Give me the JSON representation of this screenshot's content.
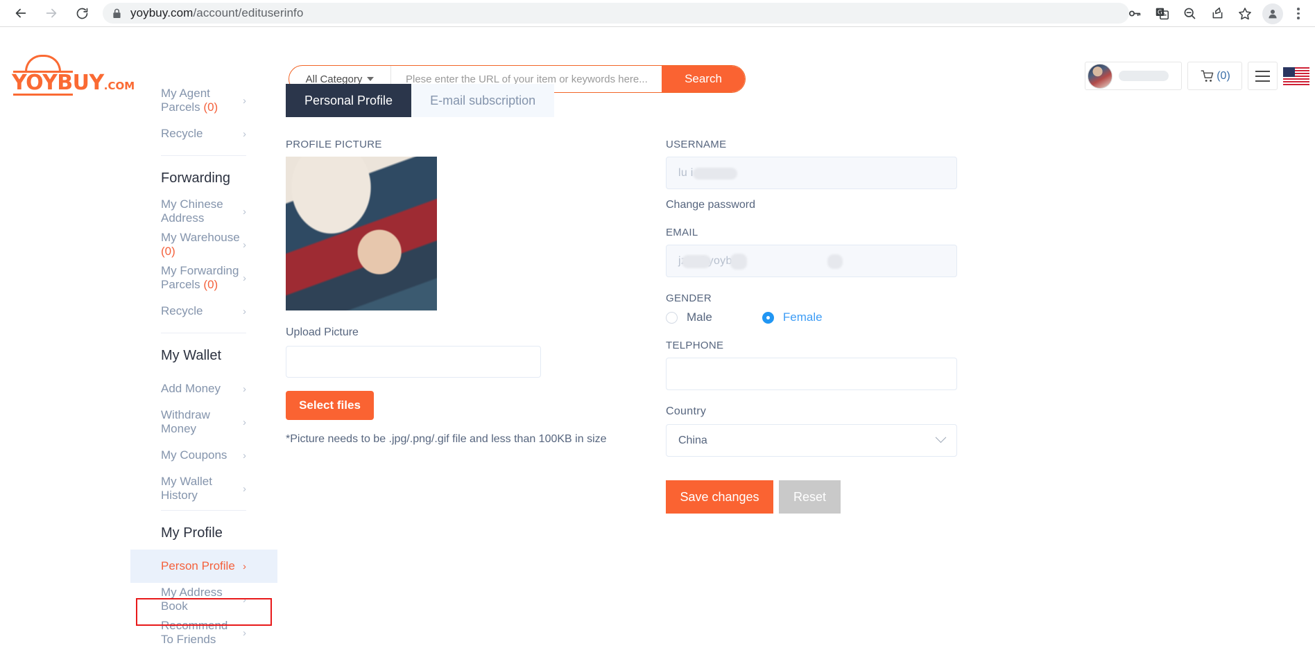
{
  "browser": {
    "url_domain": "yoybuy.com",
    "url_path": "/account/edituserinfo",
    "back_icon": "back-arrow-icon",
    "forward_icon": "forward-arrow-icon",
    "reload_icon": "reload-icon",
    "lock_icon": "lock-icon",
    "toolbar_icons": [
      "password-key-icon",
      "translate-icon",
      "zoom-out-icon",
      "share-icon",
      "bookmark-star-icon",
      "profile-avatar-icon",
      "three-dot-menu-icon"
    ]
  },
  "header": {
    "logo_main": "YOYBUY",
    "logo_suffix": ".COM",
    "category_label": "All Category",
    "search_placeholder": "Plese enter the URL of your item or keywords here...",
    "search_value": "",
    "search_button": "Search",
    "cart_count": "(0)",
    "cart_icon": "shopping-cart-icon",
    "menu_icon": "hamburger-menu-icon",
    "flag_icon": "us-flag-icon",
    "accent_color": "#fa6332"
  },
  "sidebar": {
    "items": [
      {
        "label": "My Agent Parcels",
        "count": "(0)",
        "type": "link",
        "active": false
      },
      {
        "label": "Recycle",
        "count": "",
        "type": "link",
        "active": false
      },
      {
        "label": "Forwarding",
        "count": "",
        "type": "heading",
        "active": false
      },
      {
        "label": "My Chinese Address",
        "count": "",
        "type": "link",
        "active": false
      },
      {
        "label": "My Warehouse",
        "count": "(0)",
        "type": "link",
        "active": false
      },
      {
        "label": "My Forwarding Parcels",
        "count": "(0)",
        "type": "link",
        "active": false
      },
      {
        "label": "Recycle",
        "count": "",
        "type": "link",
        "active": false
      },
      {
        "label": "My Wallet",
        "count": "",
        "type": "heading",
        "active": false
      },
      {
        "label": "Add Money",
        "count": "",
        "type": "link",
        "active": false
      },
      {
        "label": "Withdraw Money",
        "count": "",
        "type": "link",
        "active": false
      },
      {
        "label": "My Coupons",
        "count": "",
        "type": "link",
        "active": false
      },
      {
        "label": "My Wallet History",
        "count": "",
        "type": "link",
        "active": false
      },
      {
        "label": "My Profile",
        "count": "",
        "type": "heading",
        "active": false
      },
      {
        "label": "Person Profile",
        "count": "",
        "type": "link",
        "active": true
      },
      {
        "label": "My Address Book",
        "count": "",
        "type": "link",
        "active": false
      },
      {
        "label": "Recommend To Friends",
        "count": "",
        "type": "link",
        "active": false
      }
    ],
    "chevron": "›",
    "highlight_color": "#e8191a",
    "active_text_color": "#f4613c"
  },
  "main": {
    "tabs": [
      {
        "label": "Personal Profile",
        "active": true
      },
      {
        "label": "E-mail subscription",
        "active": false
      }
    ],
    "picture_label": "PROFILE PICTURE",
    "upload_label": "Upload Picture",
    "upload_value": "",
    "select_files_label": "Select files",
    "hint": "*Picture needs to be .jpg/.png/.gif file and less than 100KB in size",
    "username_label": "USERNAME",
    "username_value": "lu            i",
    "change_password_label": "Change password",
    "email_label": "EMAIL",
    "email_value": "      jzh     @yoybuy     ",
    "gender_label": "GENDER",
    "gender_options": [
      {
        "label": "Male",
        "selected": false
      },
      {
        "label": "Female",
        "selected": true
      }
    ],
    "telephone_label": "TELPHONE",
    "telephone_value": "",
    "country_label": "Country",
    "country_value": "China",
    "save_label": "Save changes",
    "reset_label": "Reset"
  }
}
